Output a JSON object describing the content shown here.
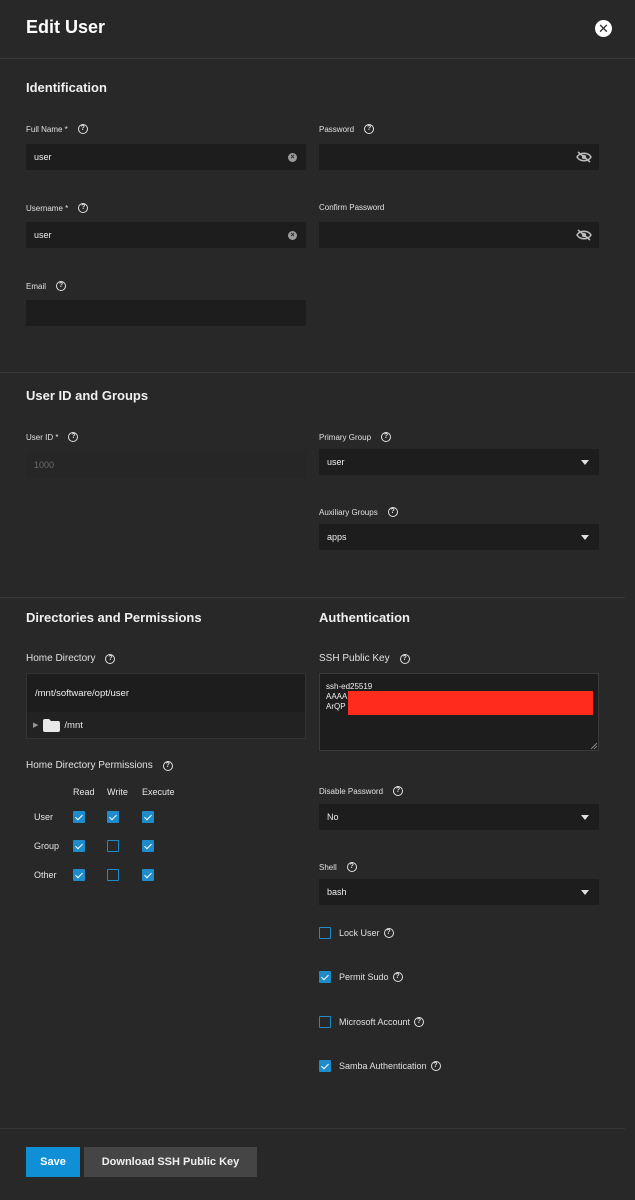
{
  "header": {
    "title": "Edit User",
    "close_icon": "close-icon"
  },
  "identification": {
    "title": "Identification",
    "full_name": {
      "label": "Full Name *",
      "value": "user"
    },
    "username": {
      "label": "Username *",
      "value": "user"
    },
    "email": {
      "label": "Email",
      "value": ""
    },
    "password": {
      "label": "Password",
      "value": ""
    },
    "confirm_password": {
      "label": "Confirm Password",
      "value": ""
    }
  },
  "user_id_groups": {
    "title": "User ID and Groups",
    "user_id": {
      "label": "User ID *",
      "value": "1000"
    },
    "primary_group": {
      "label": "Primary Group",
      "value": "user"
    },
    "auxiliary_groups": {
      "label": "Auxiliary Groups",
      "value": "apps"
    }
  },
  "directories": {
    "title": "Directories and Permissions",
    "home_directory": {
      "label": "Home Directory",
      "value": "/mnt/software/opt/user",
      "tree_item": "/mnt"
    },
    "permissions": {
      "label": "Home Directory Permissions",
      "columns": [
        "Read",
        "Write",
        "Execute"
      ],
      "rows": [
        {
          "label": "User",
          "read": true,
          "write": true,
          "execute": true
        },
        {
          "label": "Group",
          "read": true,
          "write": false,
          "execute": true
        },
        {
          "label": "Other",
          "read": true,
          "write": false,
          "execute": true
        }
      ]
    }
  },
  "authentication": {
    "title": "Authentication",
    "ssh_key": {
      "label": "SSH Public Key",
      "line1": "ssh-ed25519",
      "line2": "AAAA",
      "line3": "ArQP",
      "redaction_color": "#ff2b1c"
    },
    "disable_password": {
      "label": "Disable Password",
      "value": "No"
    },
    "shell": {
      "label": "Shell",
      "value": "bash"
    },
    "lock_user": {
      "label": "Lock User",
      "checked": false
    },
    "permit_sudo": {
      "label": "Permit Sudo",
      "checked": true
    },
    "microsoft_account": {
      "label": "Microsoft Account",
      "checked": false
    },
    "samba_auth": {
      "label": "Samba Authentication",
      "checked": true
    }
  },
  "footer": {
    "save_label": "Save",
    "download_label": "Download SSH Public Key"
  },
  "colors": {
    "accent": "#1e8bcb",
    "background": "#282828",
    "field": "#1d1d1d"
  }
}
